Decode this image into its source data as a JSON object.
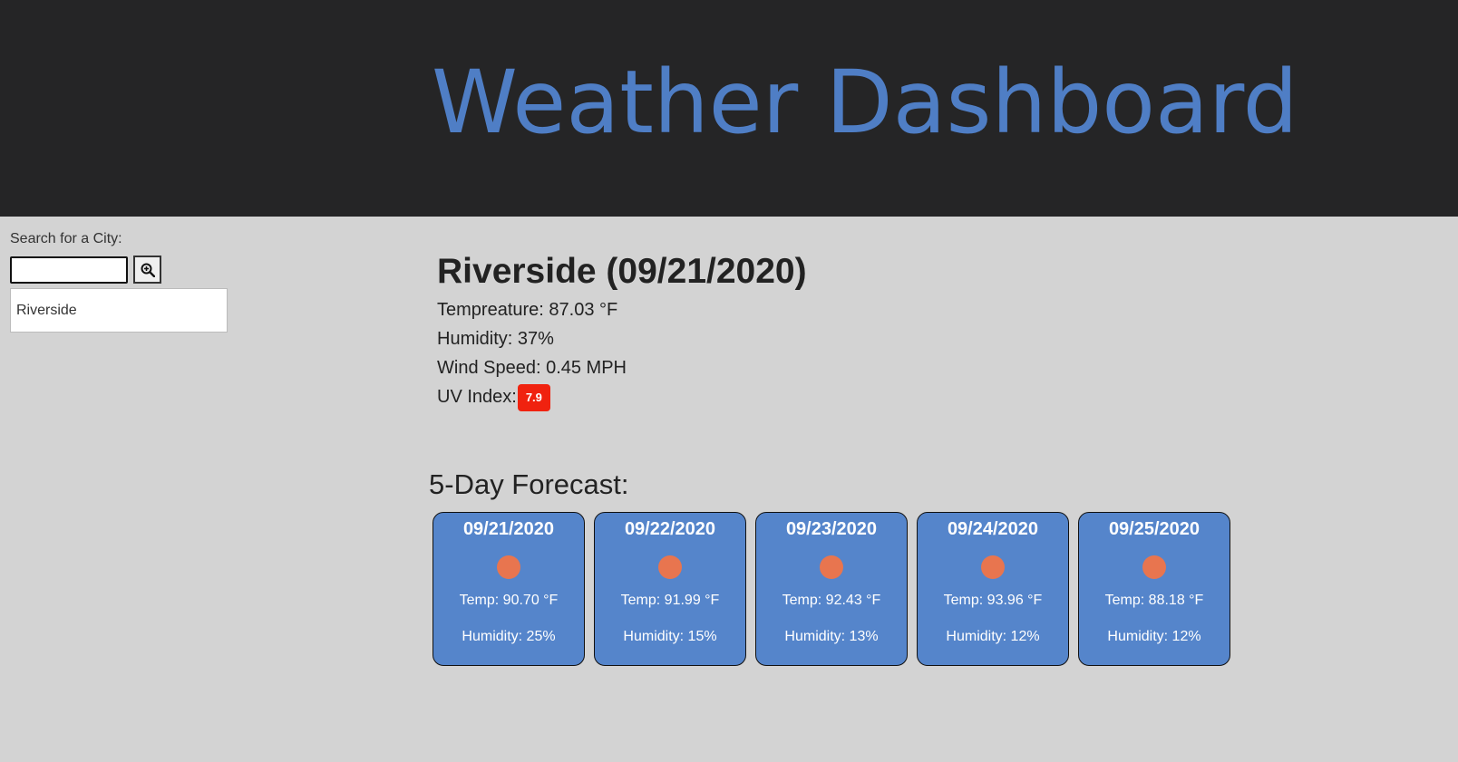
{
  "header": {
    "title": "Weather Dashboard"
  },
  "sidebar": {
    "search_label": "Search for a City:",
    "search_value": "",
    "search_icon": "zoom-in-magnifier",
    "history": [
      "Riverside"
    ]
  },
  "current": {
    "title": "Riverside (09/21/2020)",
    "temperature": "Tempreature: 87.03 °F",
    "humidity": "Humidity: 37%",
    "wind": "Wind Speed: 0.45 MPH",
    "uv_label": "UV Index:",
    "uv_value": "7.9",
    "uv_color": "#f0220f"
  },
  "forecast": {
    "title": "5-Day Forecast:",
    "icon": "sun-icon",
    "icon_color": "#e8754f",
    "card_color": "#5585cb",
    "days": [
      {
        "date": "09/21/2020",
        "temp": "Temp: 90.70 °F",
        "humidity": "Humidity: 25%"
      },
      {
        "date": "09/22/2020",
        "temp": "Temp: 91.99 °F",
        "humidity": "Humidity: 15%"
      },
      {
        "date": "09/23/2020",
        "temp": "Temp: 92.43 °F",
        "humidity": "Humidity: 13%"
      },
      {
        "date": "09/24/2020",
        "temp": "Temp: 93.96 °F",
        "humidity": "Humidity: 12%"
      },
      {
        "date": "09/25/2020",
        "temp": "Temp: 88.18 °F",
        "humidity": "Humidity: 12%"
      }
    ]
  }
}
